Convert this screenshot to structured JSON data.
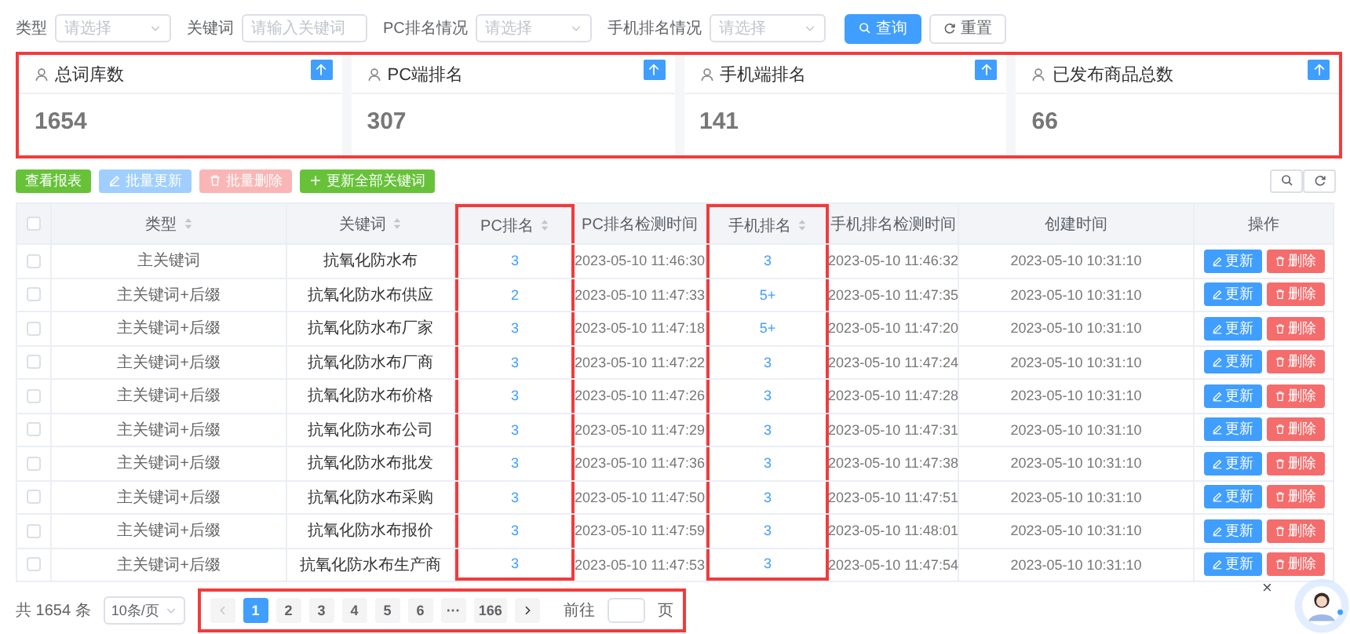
{
  "filters": [
    {
      "kind": "select",
      "label": "类型",
      "placeholder": "请选择"
    },
    {
      "kind": "input",
      "label": "关键词",
      "placeholder": "请输入关键词"
    },
    {
      "kind": "select",
      "label": "PC排名情况",
      "placeholder": "请选择"
    },
    {
      "kind": "select",
      "label": "手机排名情况",
      "placeholder": "请选择"
    }
  ],
  "filter_buttons": [
    {
      "label": "查询",
      "kind": "primary"
    },
    {
      "label": "重置",
      "kind": "default"
    }
  ],
  "stats": {
    "highlighted": true,
    "cards": [
      {
        "title": "总词库数",
        "value": "1654"
      },
      {
        "title": "PC端排名",
        "value": "307"
      },
      {
        "title": "手机端排名",
        "value": "141"
      },
      {
        "title": "已发布商品总数",
        "value": "66"
      }
    ]
  },
  "toolbar": {
    "buttons": [
      {
        "label": "查看报表",
        "kind": "view",
        "disabled": false
      },
      {
        "label": "批量更新",
        "kind": "edit",
        "disabled": true
      },
      {
        "label": "批量删除",
        "kind": "delete",
        "disabled": true
      },
      {
        "label": "更新全部关键词",
        "kind": "add",
        "disabled": false
      }
    ]
  },
  "table": {
    "header_checkbox": {
      "checked": false
    },
    "columns": [
      {
        "label": "类型",
        "sortable": true,
        "highlighted": false
      },
      {
        "label": "关键词",
        "sortable": true,
        "highlighted": false
      },
      {
        "label": "PC排名",
        "sortable": true,
        "highlighted": true
      },
      {
        "label": "PC排名检测时间",
        "sortable": false,
        "highlighted": false
      },
      {
        "label": "手机排名",
        "sortable": true,
        "highlighted": true
      },
      {
        "label": "手机排名检测时间",
        "sortable": false,
        "highlighted": false
      },
      {
        "label": "创建时间",
        "sortable": false,
        "highlighted": false
      },
      {
        "label": "操作",
        "sortable": false,
        "highlighted": false
      }
    ],
    "rows": [
      {
        "checked": false,
        "type": "主关键词",
        "keyword": "抗氧化防水布",
        "pc_rank": "3",
        "pc_check_time": "2023-05-10 11:46:30",
        "mobile_rank": "3",
        "mobile_check_time": "2023-05-10 11:46:32",
        "created": "2023-05-10 10:31:10",
        "actions": [
          {
            "label": "更新",
            "kind": "edit"
          },
          {
            "label": "删除",
            "kind": "delete"
          }
        ]
      },
      {
        "checked": false,
        "type": "主关键词+后缀",
        "keyword": "抗氧化防水布供应",
        "pc_rank": "2",
        "pc_check_time": "2023-05-10 11:47:33",
        "mobile_rank": "5+",
        "mobile_check_time": "2023-05-10 11:47:35",
        "created": "2023-05-10 10:31:10",
        "actions": [
          {
            "label": "更新",
            "kind": "edit"
          },
          {
            "label": "删除",
            "kind": "delete"
          }
        ]
      },
      {
        "checked": false,
        "type": "主关键词+后缀",
        "keyword": "抗氧化防水布厂家",
        "pc_rank": "3",
        "pc_check_time": "2023-05-10 11:47:18",
        "mobile_rank": "5+",
        "mobile_check_time": "2023-05-10 11:47:20",
        "created": "2023-05-10 10:31:10",
        "actions": [
          {
            "label": "更新",
            "kind": "edit"
          },
          {
            "label": "删除",
            "kind": "delete"
          }
        ]
      },
      {
        "checked": false,
        "type": "主关键词+后缀",
        "keyword": "抗氧化防水布厂商",
        "pc_rank": "3",
        "pc_check_time": "2023-05-10 11:47:22",
        "mobile_rank": "3",
        "mobile_check_time": "2023-05-10 11:47:24",
        "created": "2023-05-10 10:31:10",
        "actions": [
          {
            "label": "更新",
            "kind": "edit"
          },
          {
            "label": "删除",
            "kind": "delete"
          }
        ]
      },
      {
        "checked": false,
        "type": "主关键词+后缀",
        "keyword": "抗氧化防水布价格",
        "pc_rank": "3",
        "pc_check_time": "2023-05-10 11:47:26",
        "mobile_rank": "3",
        "mobile_check_time": "2023-05-10 11:47:28",
        "created": "2023-05-10 10:31:10",
        "actions": [
          {
            "label": "更新",
            "kind": "edit"
          },
          {
            "label": "删除",
            "kind": "delete"
          }
        ]
      },
      {
        "checked": false,
        "type": "主关键词+后缀",
        "keyword": "抗氧化防水布公司",
        "pc_rank": "3",
        "pc_check_time": "2023-05-10 11:47:29",
        "mobile_rank": "3",
        "mobile_check_time": "2023-05-10 11:47:31",
        "created": "2023-05-10 10:31:10",
        "actions": [
          {
            "label": "更新",
            "kind": "edit"
          },
          {
            "label": "删除",
            "kind": "delete"
          }
        ]
      },
      {
        "checked": false,
        "type": "主关键词+后缀",
        "keyword": "抗氧化防水布批发",
        "pc_rank": "3",
        "pc_check_time": "2023-05-10 11:47:36",
        "mobile_rank": "3",
        "mobile_check_time": "2023-05-10 11:47:38",
        "created": "2023-05-10 10:31:10",
        "actions": [
          {
            "label": "更新",
            "kind": "edit"
          },
          {
            "label": "删除",
            "kind": "delete"
          }
        ]
      },
      {
        "checked": false,
        "type": "主关键词+后缀",
        "keyword": "抗氧化防水布采购",
        "pc_rank": "3",
        "pc_check_time": "2023-05-10 11:47:50",
        "mobile_rank": "3",
        "mobile_check_time": "2023-05-10 11:47:51",
        "created": "2023-05-10 10:31:10",
        "actions": [
          {
            "label": "更新",
            "kind": "edit"
          },
          {
            "label": "删除",
            "kind": "delete"
          }
        ]
      },
      {
        "checked": false,
        "type": "主关键词+后缀",
        "keyword": "抗氧化防水布报价",
        "pc_rank": "3",
        "pc_check_time": "2023-05-10 11:47:59",
        "mobile_rank": "3",
        "mobile_check_time": "2023-05-10 11:48:01",
        "created": "2023-05-10 10:31:10",
        "actions": [
          {
            "label": "更新",
            "kind": "edit"
          },
          {
            "label": "删除",
            "kind": "delete"
          }
        ]
      },
      {
        "checked": false,
        "type": "主关键词+后缀",
        "keyword": "抗氧化防水布生产商",
        "pc_rank": "3",
        "pc_check_time": "2023-05-10 11:47:53",
        "mobile_rank": "3",
        "mobile_check_time": "2023-05-10 11:47:54",
        "created": "2023-05-10 10:31:10",
        "actions": [
          {
            "label": "更新",
            "kind": "edit"
          },
          {
            "label": "删除",
            "kind": "delete"
          }
        ]
      }
    ]
  },
  "pagination": {
    "highlighted": true,
    "total": "共 1654 条",
    "page_size": "10条/页",
    "prev_disabled": true,
    "next_disabled": false,
    "pages": [
      {
        "label": "1",
        "selected": true
      },
      {
        "label": "2",
        "selected": false
      },
      {
        "label": "3",
        "selected": false
      },
      {
        "label": "4",
        "selected": false
      },
      {
        "label": "5",
        "selected": false
      },
      {
        "label": "6",
        "selected": false
      },
      {
        "label": "···",
        "selected": false
      },
      {
        "label": "166",
        "selected": false
      }
    ],
    "goto_label": "前往",
    "page_unit": "页"
  },
  "assistant": {
    "close": "×"
  }
}
